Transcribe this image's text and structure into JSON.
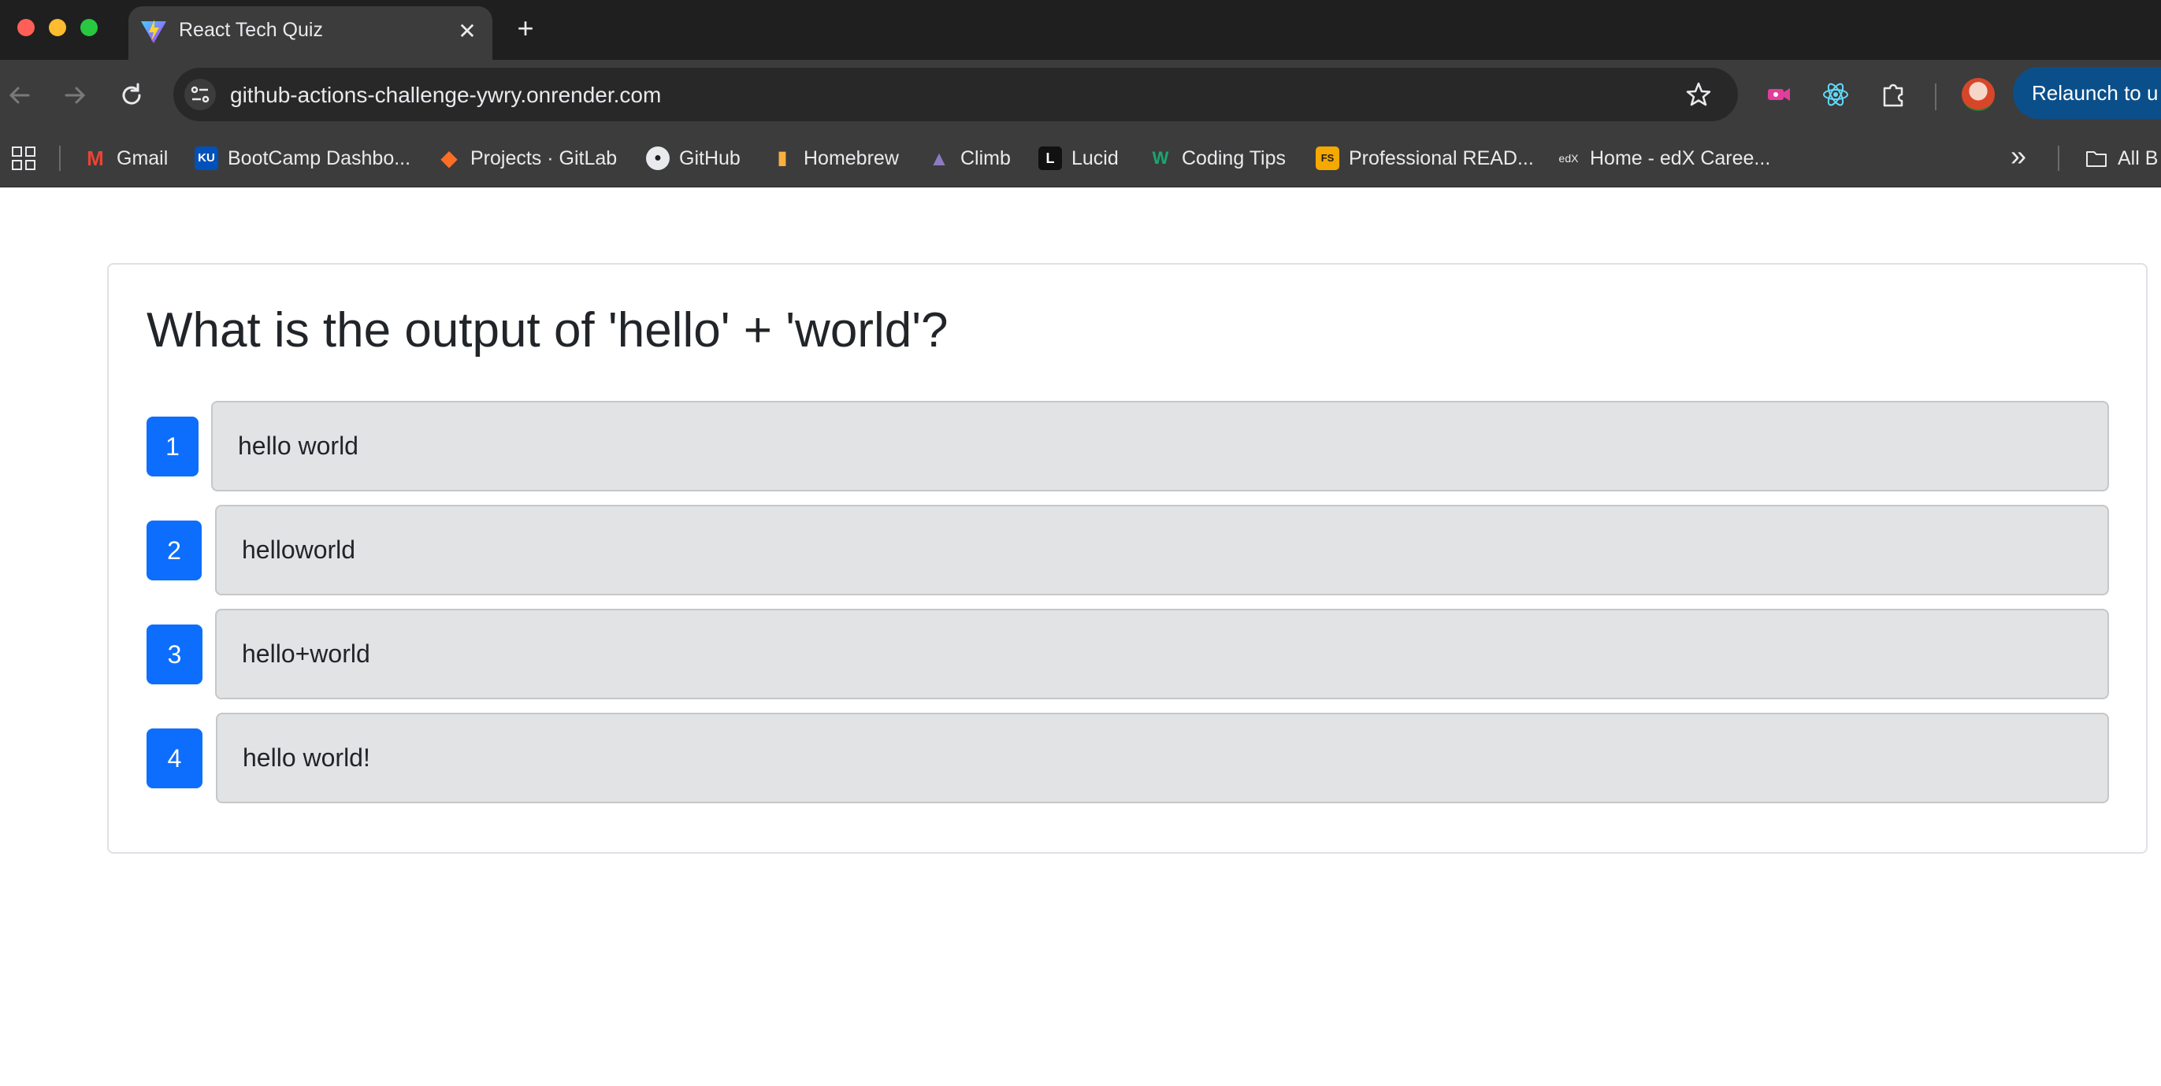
{
  "browser": {
    "tab": {
      "title": "React Tech Quiz",
      "close_label": "✕"
    },
    "new_tab_label": "+",
    "address": {
      "url": "github-actions-challenge-ywry.onrender.com"
    },
    "relaunch_label": "Relaunch to u",
    "bookmarks": [
      {
        "label": "Gmail",
        "icon": "gmail-icon"
      },
      {
        "label": "BootCamp Dashbo...",
        "icon": "ku-icon"
      },
      {
        "label": "Projects · GitLab",
        "icon": "gitlab-icon"
      },
      {
        "label": "GitHub",
        "icon": "github-icon"
      },
      {
        "label": "Homebrew",
        "icon": "homebrew-icon"
      },
      {
        "label": "Climb",
        "icon": "climb-icon"
      },
      {
        "label": "Lucid",
        "icon": "lucid-icon"
      },
      {
        "label": "Coding Tips",
        "icon": "w-icon"
      },
      {
        "label": "Professional READ...",
        "icon": "fs-icon"
      },
      {
        "label": "Home - edX Caree...",
        "icon": "edx-icon"
      }
    ],
    "bookmarks_overflow_label": "»",
    "all_bookmarks_label": "All B"
  },
  "quiz": {
    "question": "What is the output of 'hello' + 'world'?",
    "answers": [
      {
        "number": "1",
        "text": "hello world"
      },
      {
        "number": "2",
        "text": "helloworld"
      },
      {
        "number": "3",
        "text": "hello+world"
      },
      {
        "number": "4",
        "text": "hello world!"
      }
    ]
  },
  "colors": {
    "primary": "#0d6efd",
    "answer_bg": "#e2e3e5",
    "chrome_dark": "#1f1f1f",
    "chrome_mid": "#3c3c3c"
  }
}
